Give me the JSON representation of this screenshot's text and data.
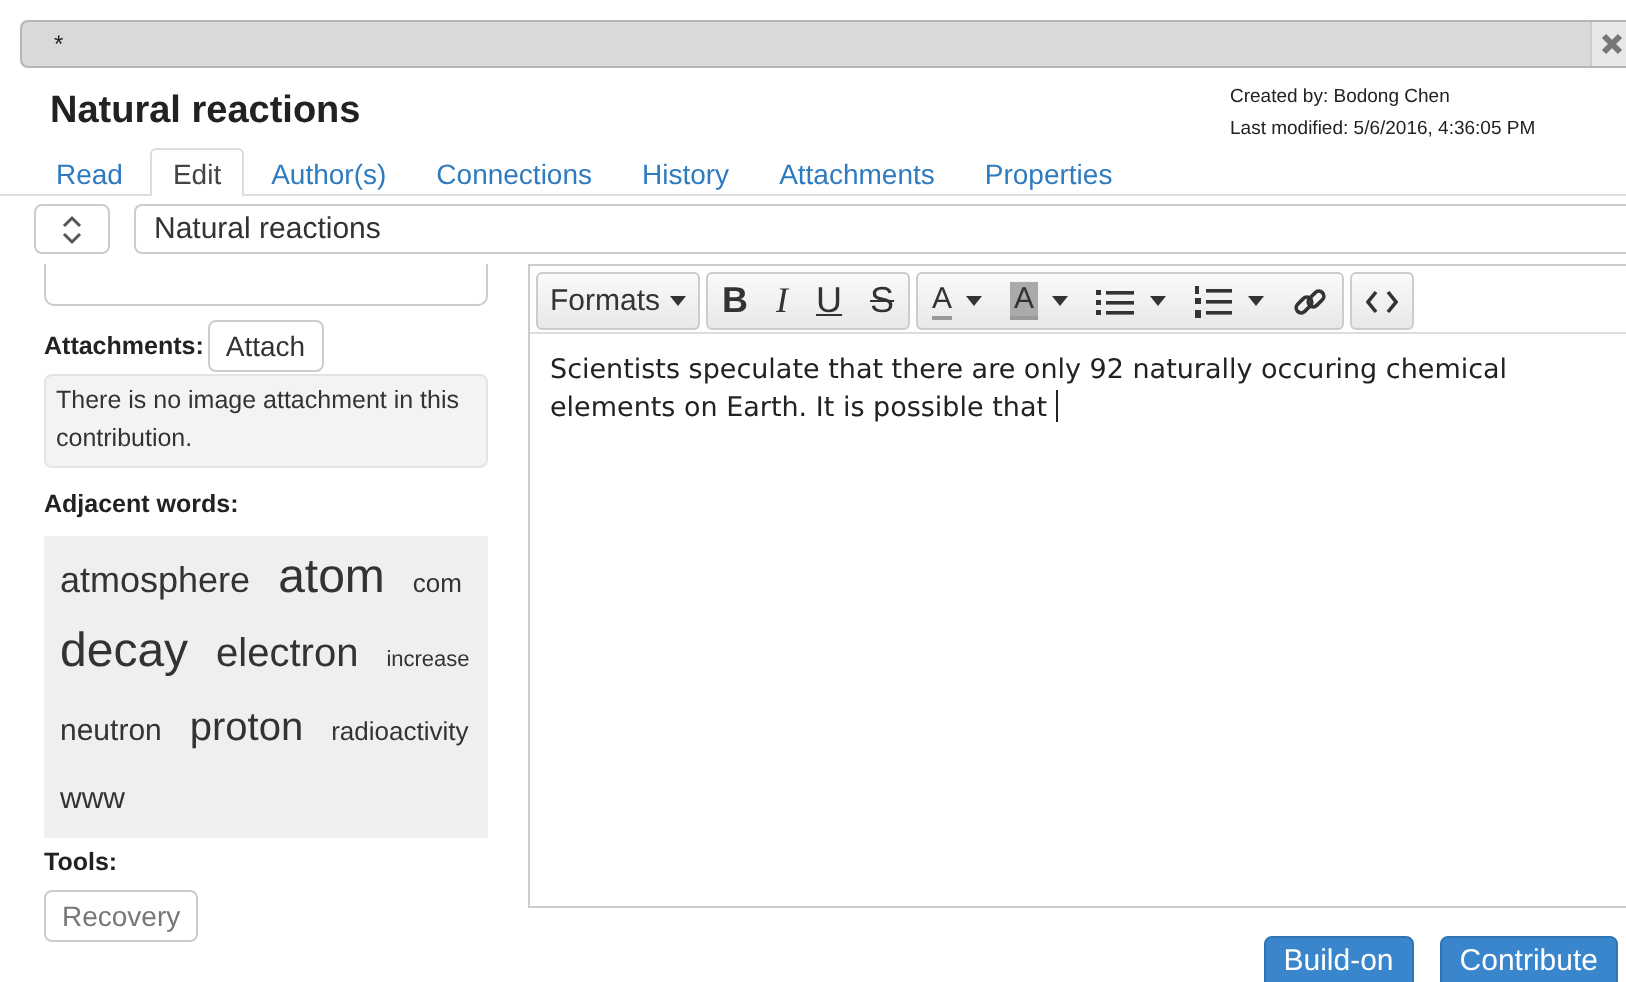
{
  "window": {
    "title": "*"
  },
  "page": {
    "title": "Natural reactions",
    "created_by": "Created by: Bodong Chen",
    "last_modified": "Last modified: 5/6/2016, 4:36:05 PM"
  },
  "tabs": [
    {
      "label": "Read",
      "selected": false
    },
    {
      "label": "Edit",
      "selected": true
    },
    {
      "label": "Author(s)",
      "selected": false
    },
    {
      "label": "Connections",
      "selected": false
    },
    {
      "label": "History",
      "selected": false
    },
    {
      "label": "Attachments",
      "selected": false
    },
    {
      "label": "Properties",
      "selected": false
    }
  ],
  "title_field": {
    "value": "Natural reactions"
  },
  "sidebar": {
    "attachments_label": "Attachments:",
    "attach_button": "Attach",
    "attachment_note": "There is no image attachment in this contribution.",
    "adjacent_label": "Adjacent words:",
    "words": [
      {
        "text": "atmosphere",
        "kind": "m"
      },
      {
        "text": "atom",
        "kind": "xl"
      },
      {
        "text": "com",
        "kind": "xs"
      },
      {
        "text": "decay",
        "kind": "xl"
      },
      {
        "text": "electron",
        "kind": "l"
      },
      {
        "text": "increase",
        "kind": "xxs"
      },
      {
        "text": "neutron",
        "kind": "s"
      },
      {
        "text": "proton",
        "kind": "l"
      },
      {
        "text": "radioactivity",
        "kind": "xs"
      },
      {
        "text": "www",
        "kind": "s"
      }
    ],
    "tools_label": "Tools:",
    "recovery_button": "Recovery"
  },
  "editor": {
    "toolbar": [
      {
        "kind": "formats",
        "label": "Formats"
      },
      {
        "kind": "group",
        "buttons": [
          {
            "kind": "bold",
            "glyph": "B"
          },
          {
            "kind": "italic",
            "glyph": "I"
          },
          {
            "kind": "underline",
            "glyph": "U"
          },
          {
            "kind": "strike",
            "glyph": "S"
          }
        ]
      },
      {
        "kind": "group",
        "buttons": [
          {
            "kind": "forecolor",
            "glyph": "A"
          },
          {
            "kind": "backcolor",
            "glyph": "A"
          },
          {
            "kind": "bullist"
          },
          {
            "kind": "numlist"
          },
          {
            "kind": "link"
          }
        ]
      },
      {
        "kind": "group",
        "buttons": [
          {
            "kind": "code"
          }
        ]
      }
    ],
    "content": "Scientists speculate that there are only 92 naturally occuring chemical elements on Earth. It is possible that"
  },
  "buttons": [
    {
      "label": "Build-on"
    },
    {
      "label": "Contribute"
    }
  ]
}
